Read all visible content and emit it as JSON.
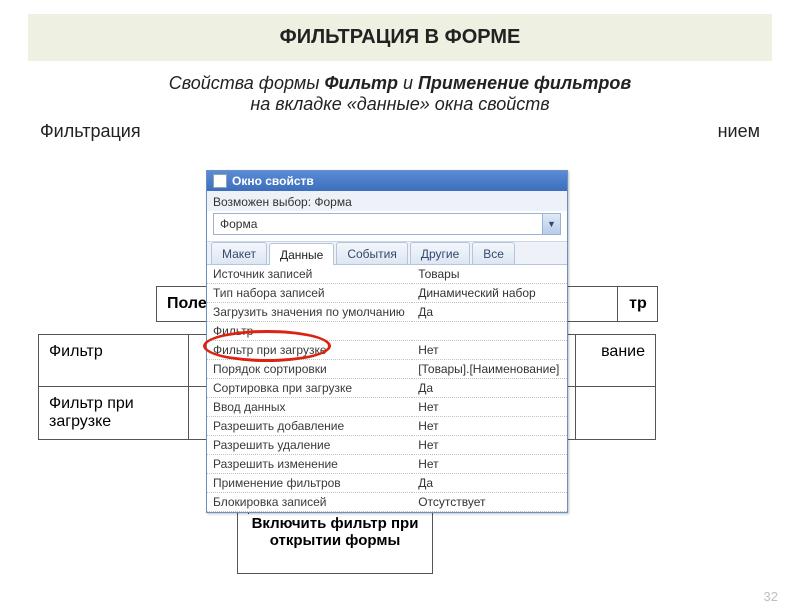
{
  "title": "ФИЛЬТРАЦИЯ В ФОРМЕ",
  "intro": {
    "pre": "Свойства формы ",
    "b1": "Фильтр",
    "mid": " и ",
    "b2": "Применение фильтров",
    "line2": "на вкладке «данные» окна свойств"
  },
  "lead": {
    "left": "Фильтрация",
    "right": "нием"
  },
  "bg_tbl1": {
    "cell": "Поле",
    "right": "тр"
  },
  "bg_tbl2": {
    "r1c1": "Фильтр",
    "r1right": "вание",
    "r2c1": "Фильтр при загрузке"
  },
  "annotation": "Включить фильтр при открытии формы",
  "page_num": "32",
  "window": {
    "title": "Окно свойств",
    "selection_label": "Возможен выбор:  Форма",
    "combo_value": "Форма",
    "tabs": [
      "Макет",
      "Данные",
      "События",
      "Другие",
      "Все"
    ],
    "active_tab": 1,
    "rows": [
      {
        "k": "Источник записей",
        "v": "Товары"
      },
      {
        "k": "Тип набора записей",
        "v": "Динамический набор"
      },
      {
        "k": "Загрузить значения по умолчанию",
        "v": "Да"
      },
      {
        "k": "Фильтр",
        "v": ""
      },
      {
        "k": "Фильтр при загрузке",
        "v": "Нет"
      },
      {
        "k": "Порядок сортировки",
        "v": "[Товары].[Наименование]"
      },
      {
        "k": "Сортировка при загрузке",
        "v": "Да"
      },
      {
        "k": "Ввод данных",
        "v": "Нет"
      },
      {
        "k": "Разрешить добавление",
        "v": "Нет"
      },
      {
        "k": "Разрешить удаление",
        "v": "Нет"
      },
      {
        "k": "Разрешить изменение",
        "v": "Нет"
      },
      {
        "k": "Применение фильтров",
        "v": "Да"
      },
      {
        "k": "Блокировка записей",
        "v": "Отсутствует"
      }
    ]
  }
}
